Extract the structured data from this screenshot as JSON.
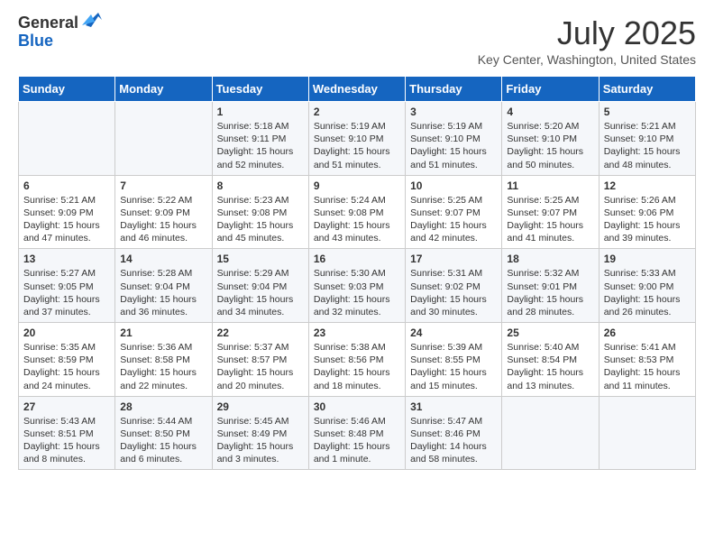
{
  "header": {
    "logo_general": "General",
    "logo_blue": "Blue",
    "title": "July 2025",
    "location": "Key Center, Washington, United States"
  },
  "columns": [
    "Sunday",
    "Monday",
    "Tuesday",
    "Wednesday",
    "Thursday",
    "Friday",
    "Saturday"
  ],
  "weeks": [
    [
      {
        "day": "",
        "sunrise": "",
        "sunset": "",
        "daylight": ""
      },
      {
        "day": "",
        "sunrise": "",
        "sunset": "",
        "daylight": ""
      },
      {
        "day": "1",
        "sunrise": "Sunrise: 5:18 AM",
        "sunset": "Sunset: 9:11 PM",
        "daylight": "Daylight: 15 hours and 52 minutes."
      },
      {
        "day": "2",
        "sunrise": "Sunrise: 5:19 AM",
        "sunset": "Sunset: 9:10 PM",
        "daylight": "Daylight: 15 hours and 51 minutes."
      },
      {
        "day": "3",
        "sunrise": "Sunrise: 5:19 AM",
        "sunset": "Sunset: 9:10 PM",
        "daylight": "Daylight: 15 hours and 51 minutes."
      },
      {
        "day": "4",
        "sunrise": "Sunrise: 5:20 AM",
        "sunset": "Sunset: 9:10 PM",
        "daylight": "Daylight: 15 hours and 50 minutes."
      },
      {
        "day": "5",
        "sunrise": "Sunrise: 5:21 AM",
        "sunset": "Sunset: 9:10 PM",
        "daylight": "Daylight: 15 hours and 48 minutes."
      }
    ],
    [
      {
        "day": "6",
        "sunrise": "Sunrise: 5:21 AM",
        "sunset": "Sunset: 9:09 PM",
        "daylight": "Daylight: 15 hours and 47 minutes."
      },
      {
        "day": "7",
        "sunrise": "Sunrise: 5:22 AM",
        "sunset": "Sunset: 9:09 PM",
        "daylight": "Daylight: 15 hours and 46 minutes."
      },
      {
        "day": "8",
        "sunrise": "Sunrise: 5:23 AM",
        "sunset": "Sunset: 9:08 PM",
        "daylight": "Daylight: 15 hours and 45 minutes."
      },
      {
        "day": "9",
        "sunrise": "Sunrise: 5:24 AM",
        "sunset": "Sunset: 9:08 PM",
        "daylight": "Daylight: 15 hours and 43 minutes."
      },
      {
        "day": "10",
        "sunrise": "Sunrise: 5:25 AM",
        "sunset": "Sunset: 9:07 PM",
        "daylight": "Daylight: 15 hours and 42 minutes."
      },
      {
        "day": "11",
        "sunrise": "Sunrise: 5:25 AM",
        "sunset": "Sunset: 9:07 PM",
        "daylight": "Daylight: 15 hours and 41 minutes."
      },
      {
        "day": "12",
        "sunrise": "Sunrise: 5:26 AM",
        "sunset": "Sunset: 9:06 PM",
        "daylight": "Daylight: 15 hours and 39 minutes."
      }
    ],
    [
      {
        "day": "13",
        "sunrise": "Sunrise: 5:27 AM",
        "sunset": "Sunset: 9:05 PM",
        "daylight": "Daylight: 15 hours and 37 minutes."
      },
      {
        "day": "14",
        "sunrise": "Sunrise: 5:28 AM",
        "sunset": "Sunset: 9:04 PM",
        "daylight": "Daylight: 15 hours and 36 minutes."
      },
      {
        "day": "15",
        "sunrise": "Sunrise: 5:29 AM",
        "sunset": "Sunset: 9:04 PM",
        "daylight": "Daylight: 15 hours and 34 minutes."
      },
      {
        "day": "16",
        "sunrise": "Sunrise: 5:30 AM",
        "sunset": "Sunset: 9:03 PM",
        "daylight": "Daylight: 15 hours and 32 minutes."
      },
      {
        "day": "17",
        "sunrise": "Sunrise: 5:31 AM",
        "sunset": "Sunset: 9:02 PM",
        "daylight": "Daylight: 15 hours and 30 minutes."
      },
      {
        "day": "18",
        "sunrise": "Sunrise: 5:32 AM",
        "sunset": "Sunset: 9:01 PM",
        "daylight": "Daylight: 15 hours and 28 minutes."
      },
      {
        "day": "19",
        "sunrise": "Sunrise: 5:33 AM",
        "sunset": "Sunset: 9:00 PM",
        "daylight": "Daylight: 15 hours and 26 minutes."
      }
    ],
    [
      {
        "day": "20",
        "sunrise": "Sunrise: 5:35 AM",
        "sunset": "Sunset: 8:59 PM",
        "daylight": "Daylight: 15 hours and 24 minutes."
      },
      {
        "day": "21",
        "sunrise": "Sunrise: 5:36 AM",
        "sunset": "Sunset: 8:58 PM",
        "daylight": "Daylight: 15 hours and 22 minutes."
      },
      {
        "day": "22",
        "sunrise": "Sunrise: 5:37 AM",
        "sunset": "Sunset: 8:57 PM",
        "daylight": "Daylight: 15 hours and 20 minutes."
      },
      {
        "day": "23",
        "sunrise": "Sunrise: 5:38 AM",
        "sunset": "Sunset: 8:56 PM",
        "daylight": "Daylight: 15 hours and 18 minutes."
      },
      {
        "day": "24",
        "sunrise": "Sunrise: 5:39 AM",
        "sunset": "Sunset: 8:55 PM",
        "daylight": "Daylight: 15 hours and 15 minutes."
      },
      {
        "day": "25",
        "sunrise": "Sunrise: 5:40 AM",
        "sunset": "Sunset: 8:54 PM",
        "daylight": "Daylight: 15 hours and 13 minutes."
      },
      {
        "day": "26",
        "sunrise": "Sunrise: 5:41 AM",
        "sunset": "Sunset: 8:53 PM",
        "daylight": "Daylight: 15 hours and 11 minutes."
      }
    ],
    [
      {
        "day": "27",
        "sunrise": "Sunrise: 5:43 AM",
        "sunset": "Sunset: 8:51 PM",
        "daylight": "Daylight: 15 hours and 8 minutes."
      },
      {
        "day": "28",
        "sunrise": "Sunrise: 5:44 AM",
        "sunset": "Sunset: 8:50 PM",
        "daylight": "Daylight: 15 hours and 6 minutes."
      },
      {
        "day": "29",
        "sunrise": "Sunrise: 5:45 AM",
        "sunset": "Sunset: 8:49 PM",
        "daylight": "Daylight: 15 hours and 3 minutes."
      },
      {
        "day": "30",
        "sunrise": "Sunrise: 5:46 AM",
        "sunset": "Sunset: 8:48 PM",
        "daylight": "Daylight: 15 hours and 1 minute."
      },
      {
        "day": "31",
        "sunrise": "Sunrise: 5:47 AM",
        "sunset": "Sunset: 8:46 PM",
        "daylight": "Daylight: 14 hours and 58 minutes."
      },
      {
        "day": "",
        "sunrise": "",
        "sunset": "",
        "daylight": ""
      },
      {
        "day": "",
        "sunrise": "",
        "sunset": "",
        "daylight": ""
      }
    ]
  ]
}
